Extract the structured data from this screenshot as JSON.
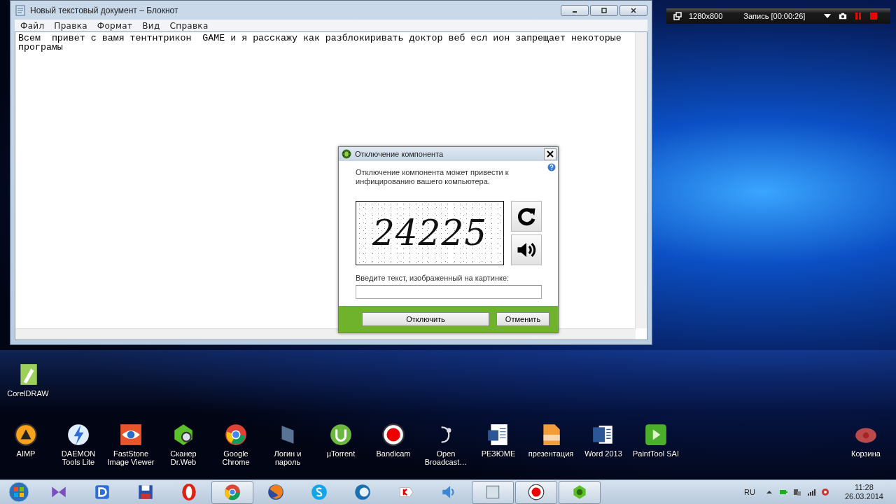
{
  "notepad": {
    "title": "Новый текстовый документ – Блокнот",
    "menu": [
      "Файл",
      "Правка",
      "Формат",
      "Вид",
      "Справка"
    ],
    "text": "Всем  привет с вамя тентнтрикон  GAME и я расскажу как разблокиривать доктор веб есл ион запрещает некоторые програмы"
  },
  "recorder": {
    "resolution": "1280x800",
    "status": "Запись [00:00:26]"
  },
  "dialog": {
    "title": "Отключение компонента",
    "message": "Отключение компонента может привести к инфицированию вашего компьютера.",
    "captcha_text": "24225",
    "prompt": "Введите текст, изображенный на картинке:",
    "buttons": [
      "Отключить",
      "Отменить"
    ]
  },
  "desktop_icons": [
    {
      "label": "CorelDRAW"
    },
    {
      "label": "AIMP"
    },
    {
      "label": "DAEMON Tools Lite"
    },
    {
      "label": "FastStone Image Viewer"
    },
    {
      "label": "Сканер Dr.Web"
    },
    {
      "label": "Google Chrome"
    },
    {
      "label": "Логин и пароль"
    },
    {
      "label": "µTorrent"
    },
    {
      "label": "Bandicam"
    },
    {
      "label": "Open Broadcast…"
    },
    {
      "label": "РЕЗЮМЕ"
    },
    {
      "label": "презентация"
    },
    {
      "label": "Word 2013"
    },
    {
      "label": "PaintTool SAI"
    },
    {
      "label": "Корзина"
    }
  ],
  "taskbar": {
    "items": [
      {
        "running": false
      },
      {
        "running": false
      },
      {
        "running": false
      },
      {
        "running": false
      },
      {
        "running": true
      },
      {
        "running": false
      },
      {
        "running": false
      },
      {
        "running": false
      },
      {
        "running": false
      },
      {
        "running": false
      },
      {
        "running": true
      },
      {
        "running": true
      },
      {
        "running": true
      }
    ]
  },
  "tray": {
    "language": "RU",
    "time": "11:28",
    "date": "26.03.2014"
  }
}
